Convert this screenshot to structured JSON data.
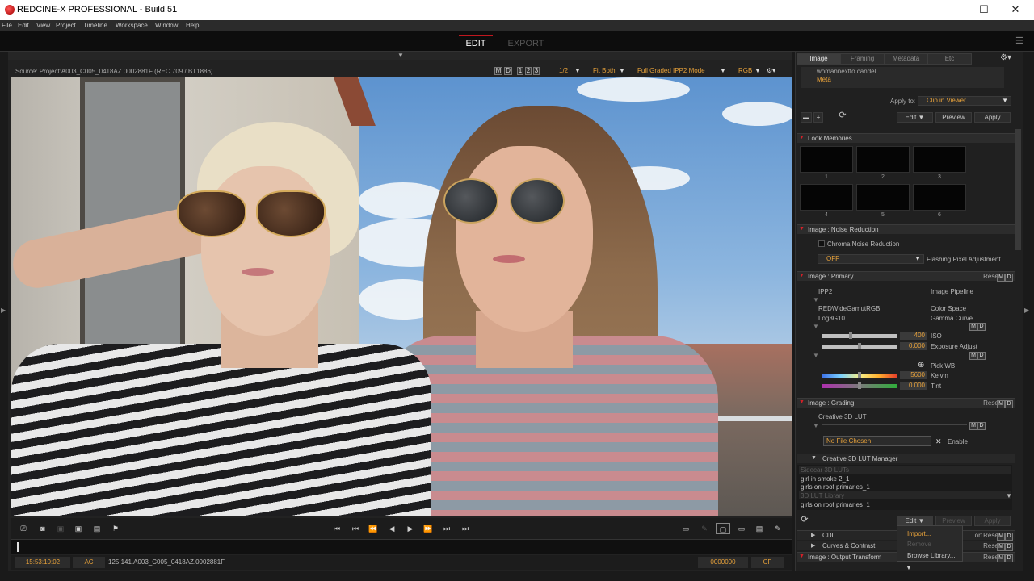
{
  "window": {
    "title": "REDCINE-X PROFESSIONAL - Build 51",
    "minimize": "—",
    "maximize": "☐",
    "close": "✕"
  },
  "menu": [
    "File",
    "Edit",
    "View",
    "Project",
    "Timeline",
    "Workspace",
    "Window",
    "Help"
  ],
  "modes": {
    "edit": "EDIT",
    "export": "EXPORT"
  },
  "viewer": {
    "source": "Source: Project:A003_C005_0418AZ.0002881F    (REC 709 / BT1886)",
    "m": "M",
    "d": "D",
    "pages": [
      "1",
      "2",
      "3"
    ],
    "res": "1/2",
    "fit": "Fit Both",
    "mode": "Full Graded IPP2 Mode",
    "channel": "RGB"
  },
  "info": {
    "timecode": "15:53:10:02",
    "ac": "AC",
    "clip": "125.141.A003_C005_0418AZ.0002881F",
    "frames": "0000000",
    "cf": "CF"
  },
  "panel": {
    "tabs": [
      "Image",
      "Framing",
      "Metadata",
      "Etc"
    ],
    "presets": [
      "womannextto candel",
      "Meta"
    ],
    "apply_to_label": "Apply to:",
    "apply_to": "Clip in Viewer",
    "edit": "Edit",
    "preview": "Preview",
    "apply": "Apply",
    "look_memories": {
      "header": "Look Memories",
      "slots": [
        "1",
        "2",
        "3",
        "4",
        "5",
        "6"
      ]
    },
    "noise": {
      "header": "Image : Noise Reduction",
      "chroma": "Chroma Noise Reduction",
      "off": "OFF",
      "flashing": "Flashing Pixel Adjustment"
    },
    "primary": {
      "header": "Image : Primary",
      "reset": "Reset",
      "ipp2": "IPP2",
      "pipeline": "Image Pipeline",
      "gamut": "REDWideGamutRGB",
      "color_space": "Color Space",
      "log": "Log3G10",
      "gamma": "Gamma Curve",
      "iso_val": "400",
      "iso": "ISO",
      "exp_val": "0.000",
      "exp": "Exposure Adjust",
      "pick_wb": "Pick WB",
      "kelvin_val": "5600",
      "kelvin": "Kelvin",
      "tint_val": "0.000",
      "tint": "Tint"
    },
    "grading": {
      "header": "Image : Grading",
      "reset": "Reset",
      "lut": "Creative 3D LUT",
      "nofile": "No File Chosen",
      "x": "✕",
      "enable": "Enable"
    },
    "lut_manager": {
      "header": "Creative 3D LUT Manager",
      "rows": [
        "Sidecar 3D LUTs",
        "girl in smoke 2_1",
        "girls on roof primaries_1",
        "3D LUT Library",
        "girls on roof primaries_1"
      ]
    },
    "bottom": {
      "edit": "Edit",
      "preview": "Preview",
      "apply": "Apply",
      "cdl": "CDL",
      "curves": "Curves & Contrast",
      "output": "Image : Output Transform",
      "ort": "ort",
      "reset": "Reset"
    },
    "popup": [
      "Import...",
      "Remove",
      "Browse Library..."
    ]
  }
}
